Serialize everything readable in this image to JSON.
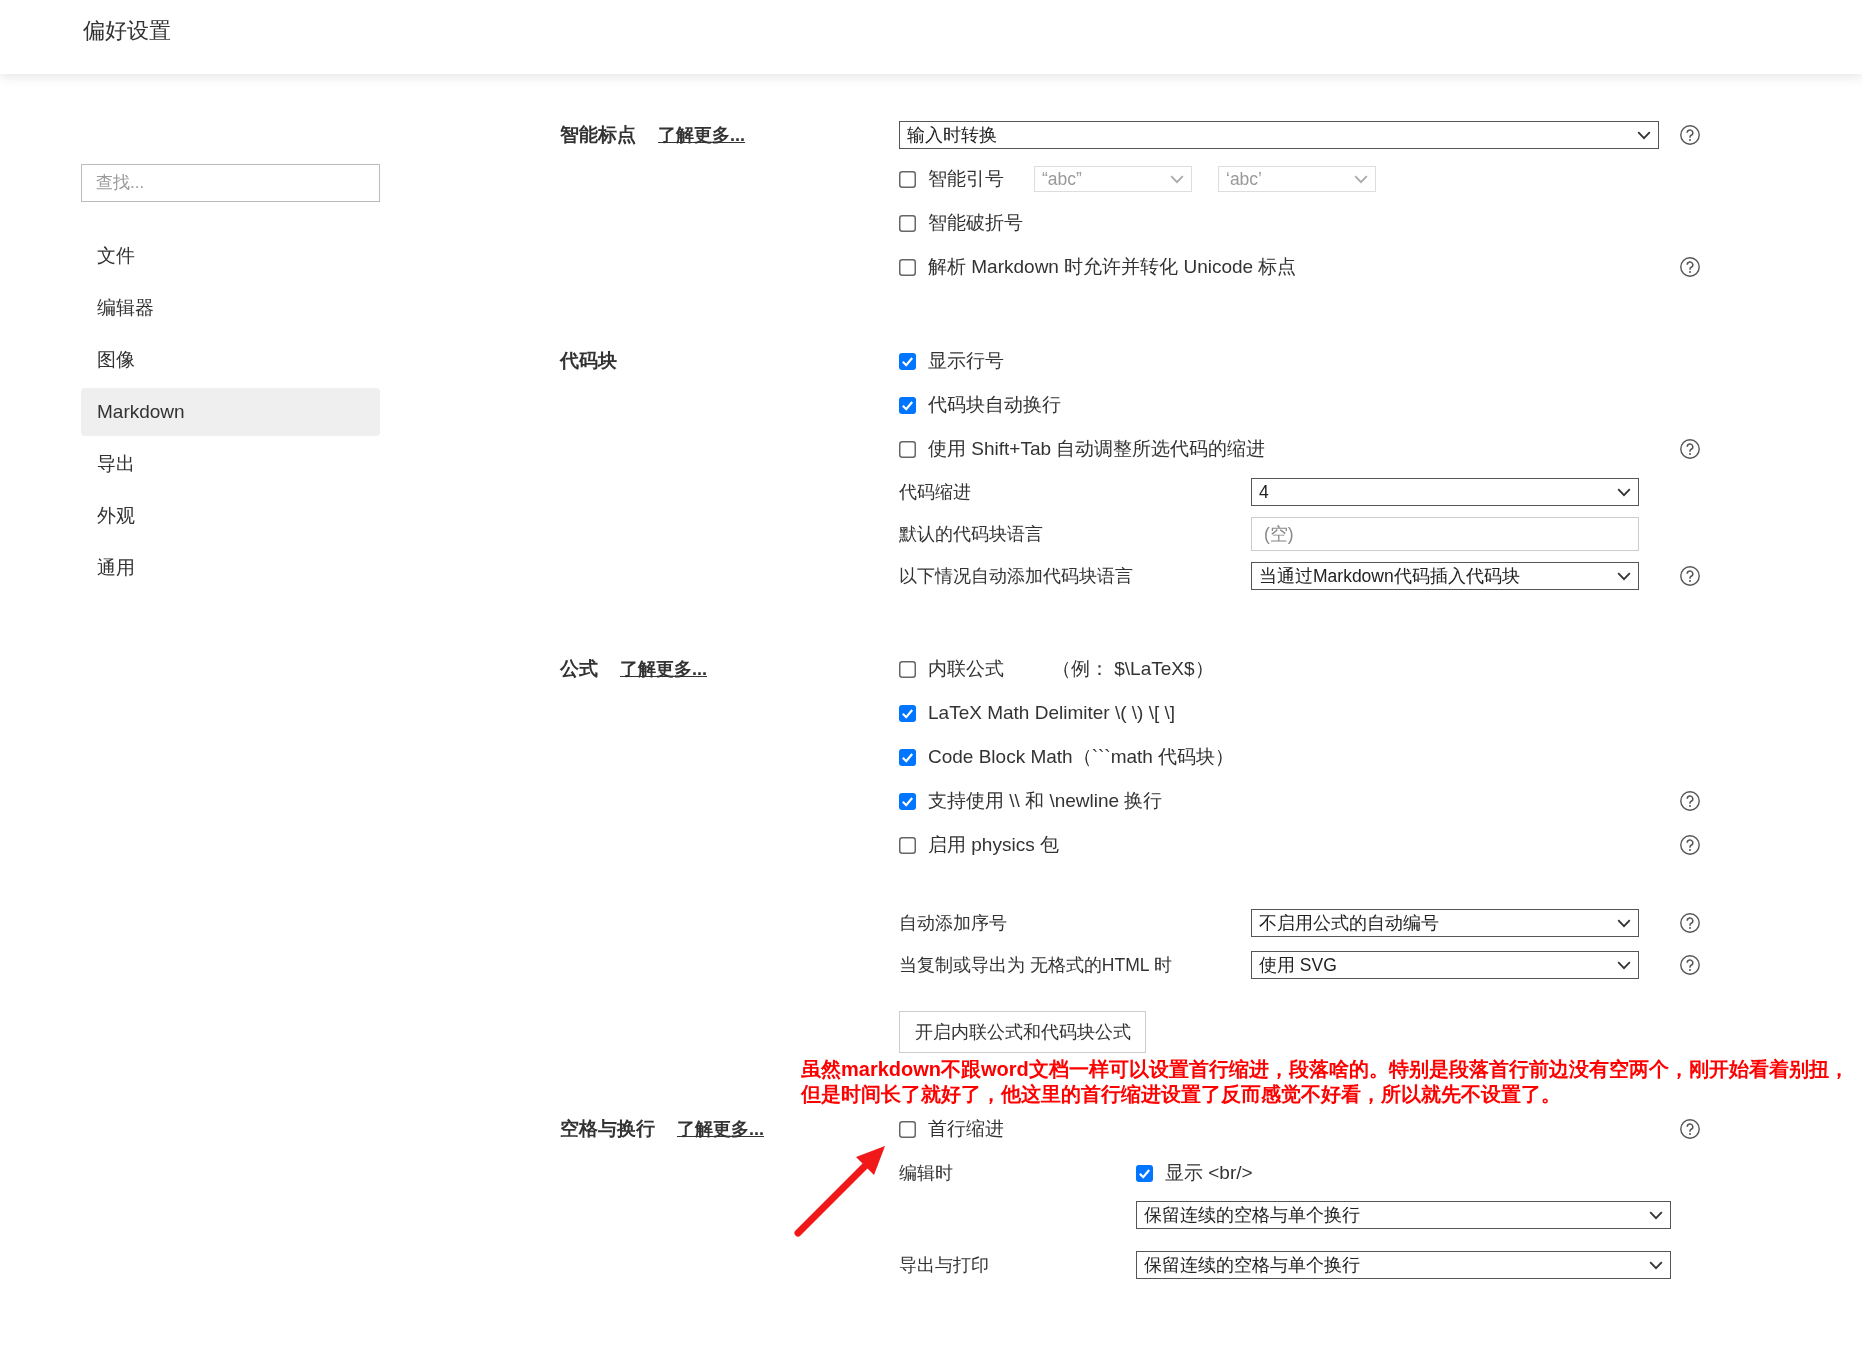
{
  "window": {
    "title": "偏好设置"
  },
  "sidebar": {
    "search": {
      "placeholder": "查找..."
    },
    "items": [
      {
        "label": "文件",
        "selected": false
      },
      {
        "label": "编辑器",
        "selected": false
      },
      {
        "label": "图像",
        "selected": false
      },
      {
        "label": "Markdown",
        "selected": true
      },
      {
        "label": "导出",
        "selected": false
      },
      {
        "label": "外观",
        "selected": false
      },
      {
        "label": "通用",
        "selected": false
      }
    ]
  },
  "sections": [
    {
      "title": "智能标点",
      "link": "了解更多...",
      "groups": [
        {
          "rows": [
            {
              "kind": "select",
              "value": "输入时转换",
              "help": true
            },
            {
              "kind": "checkbox",
              "label": "智能引号",
              "checked": false,
              "selects": [
                {
                  "value": "“abc”",
                  "disabled": true
                },
                {
                  "value": "‘abc’",
                  "disabled": true
                }
              ]
            },
            {
              "kind": "checkbox",
              "label": "智能破折号",
              "checked": false
            },
            {
              "kind": "checkbox",
              "label": "解析 Markdown 时允许并转化 Unicode 标点",
              "checked": false,
              "help": true
            }
          ]
        }
      ]
    },
    {
      "title": "代码块",
      "groups": [
        {
          "rows": [
            {
              "kind": "checkbox",
              "label": "显示行号",
              "checked": true
            },
            {
              "kind": "checkbox",
              "label": "代码块自动换行",
              "checked": true
            },
            {
              "kind": "checkbox",
              "label": "使用 Shift+Tab 自动调整所选代码的缩进",
              "checked": false,
              "help": true
            },
            {
              "kind": "labeled-select",
              "label": "代码缩进",
              "value": "4"
            },
            {
              "kind": "labeled-input",
              "label": "默认的代码块语言",
              "placeholder": "(空)"
            },
            {
              "kind": "labeled-select",
              "label": "以下情况自动添加代码块语言",
              "value": "当通过Markdown代码插入代码块",
              "help": true
            }
          ]
        }
      ]
    },
    {
      "title": "公式",
      "link": "了解更多...",
      "groups": [
        {
          "rows": [
            {
              "kind": "checkbox",
              "label": "内联公式",
              "note": "（例： $\\LaTeX$）",
              "checked": false
            },
            {
              "kind": "checkbox",
              "label": "LaTeX Math Delimiter \\( \\) \\[ \\]",
              "checked": true
            },
            {
              "kind": "checkbox",
              "label": "Code Block Math（```math 代码块）",
              "checked": true
            },
            {
              "kind": "checkbox",
              "label": "支持使用 \\\\ 和 \\newline 换行",
              "checked": true,
              "help": true
            },
            {
              "kind": "checkbox",
              "label": "启用 physics 包",
              "checked": false,
              "help": true
            }
          ]
        },
        {
          "rows": [
            {
              "kind": "labeled-select",
              "label": "自动添加序号",
              "value": "不启用公式的自动编号",
              "help": true
            },
            {
              "kind": "labeled-select",
              "label": "当复制或导出为 无格式的HTML 时",
              "value": "使用 SVG",
              "help": true
            },
            {
              "kind": "button",
              "label": "开启内联公式和代码块公式"
            }
          ]
        }
      ]
    },
    {
      "title": "空格与换行",
      "link": "了解更多...",
      "annotation": {
        "text": "虽然markdown不跟word文档一样可以设置首行缩进，段落啥的。特别是段落首行前边没有空两个，刚开始看着别扭，但是时间长了就好了，他这里的首行缩进设置了反而感觉不好看，所以就先不设置了。"
      },
      "groups": [
        {
          "rows": [
            {
              "kind": "checkbox",
              "label": "首行缩进",
              "checked": false,
              "help": true
            },
            {
              "kind": "labeled-group",
              "label": "编辑时",
              "checkbox": {
                "label": "显示 <br/>",
                "checked": true
              },
              "select": {
                "value": "保留连续的空格与单个换行"
              }
            },
            {
              "kind": "labeled-group",
              "label": "导出与打印",
              "select": {
                "value": "保留连续的空格与单个换行"
              }
            }
          ]
        }
      ]
    }
  ]
}
